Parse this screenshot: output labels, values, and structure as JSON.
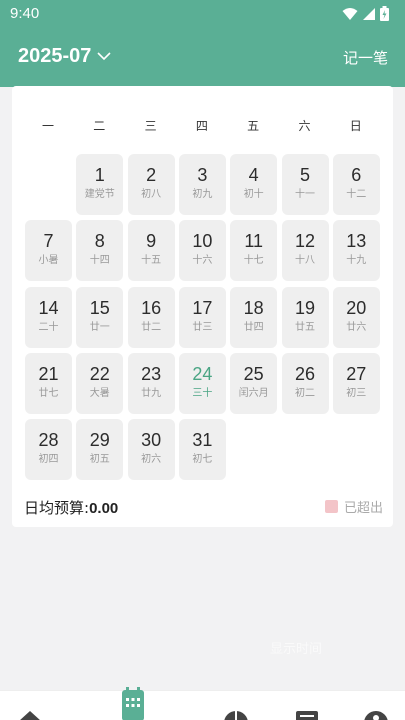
{
  "status_bar": {
    "time": "9:40"
  },
  "header": {
    "month": "2025-07",
    "record_button": "记一笔"
  },
  "weekdays": [
    "一",
    "二",
    "三",
    "四",
    "五",
    "六",
    "日"
  ],
  "days": [
    {
      "num": "1",
      "lunar": "建党节"
    },
    {
      "num": "2",
      "lunar": "初八"
    },
    {
      "num": "3",
      "lunar": "初九"
    },
    {
      "num": "4",
      "lunar": "初十"
    },
    {
      "num": "5",
      "lunar": "十一"
    },
    {
      "num": "6",
      "lunar": "十二"
    },
    {
      "num": "7",
      "lunar": "小暑"
    },
    {
      "num": "8",
      "lunar": "十四"
    },
    {
      "num": "9",
      "lunar": "十五"
    },
    {
      "num": "10",
      "lunar": "十六"
    },
    {
      "num": "11",
      "lunar": "十七"
    },
    {
      "num": "12",
      "lunar": "十八"
    },
    {
      "num": "13",
      "lunar": "十九"
    },
    {
      "num": "14",
      "lunar": "二十"
    },
    {
      "num": "15",
      "lunar": "廿一"
    },
    {
      "num": "16",
      "lunar": "廿二"
    },
    {
      "num": "17",
      "lunar": "廿三"
    },
    {
      "num": "18",
      "lunar": "廿四"
    },
    {
      "num": "19",
      "lunar": "廿五"
    },
    {
      "num": "20",
      "lunar": "廿六"
    },
    {
      "num": "21",
      "lunar": "廿七"
    },
    {
      "num": "22",
      "lunar": "大暑"
    },
    {
      "num": "23",
      "lunar": "廿九"
    },
    {
      "num": "24",
      "lunar": "三十"
    },
    {
      "num": "25",
      "lunar": "闰六月"
    },
    {
      "num": "26",
      "lunar": "初二"
    },
    {
      "num": "27",
      "lunar": "初三"
    },
    {
      "num": "28",
      "lunar": "初四"
    },
    {
      "num": "29",
      "lunar": "初五"
    },
    {
      "num": "30",
      "lunar": "初六"
    },
    {
      "num": "31",
      "lunar": "初七"
    }
  ],
  "today": "24",
  "budget": {
    "label": "日均预算:",
    "value": "0.00"
  },
  "legend": {
    "label": "已超出",
    "color": "#f3c4c8"
  },
  "watermark": "显示时间",
  "colors": {
    "accent": "#5aaf95",
    "today_text": "#4aa584"
  },
  "bottom_nav": {
    "icons": [
      "home-icon",
      "calendar-icon",
      "pie-chart-icon",
      "list-icon",
      "profile-icon"
    ],
    "active": "calendar-icon"
  }
}
